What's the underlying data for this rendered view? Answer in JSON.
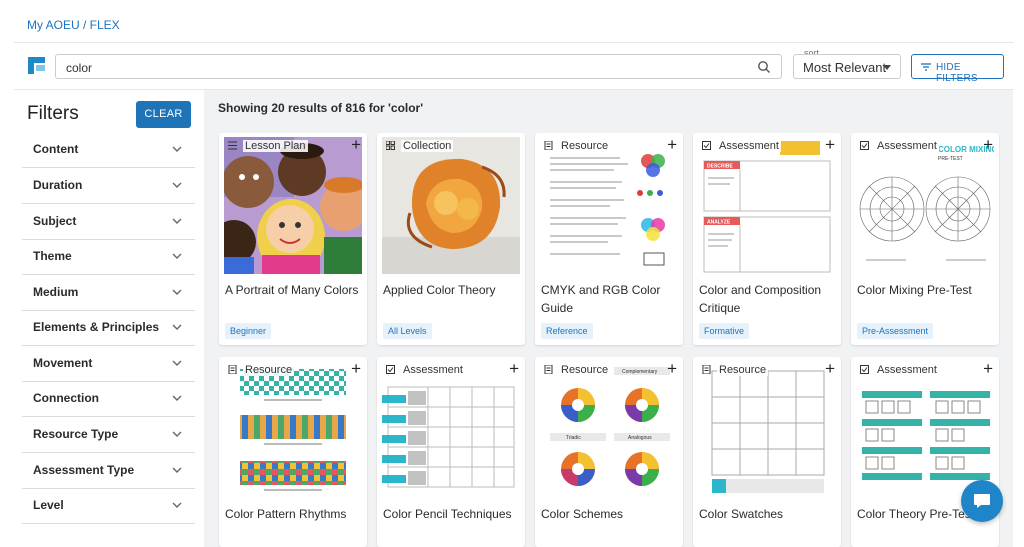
{
  "breadcrumb": "My AOEU / FLEX",
  "search": {
    "value": "color"
  },
  "sort": {
    "label": "sort",
    "value": "Most Relevant"
  },
  "hide_filters": "HIDE FILTERS",
  "filters": {
    "title": "Filters",
    "clear": "CLEAR",
    "items": [
      "Content",
      "Duration",
      "Subject",
      "Theme",
      "Medium",
      "Elements & Principles",
      "Movement",
      "Connection",
      "Resource Type",
      "Assessment Type",
      "Level"
    ]
  },
  "results_text": "Showing 20 results of 816 for 'color'",
  "cards": [
    {
      "type": "Lesson Plan",
      "title": "A Portrait of Many Colors",
      "tag": "Beginner"
    },
    {
      "type": "Collection",
      "title": "Applied Color Theory",
      "tag": "All Levels"
    },
    {
      "type": "Resource",
      "title": "CMYK and RGB Color Guide",
      "tag": "Reference"
    },
    {
      "type": "Assessment",
      "title": "Color and Composition Critique",
      "tag": "Formative"
    },
    {
      "type": "Assessment",
      "title": "Color Mixing Pre-Test",
      "tag": "Pre-Assessment"
    },
    {
      "type": "Resource",
      "title": "Color Pattern Rhythms",
      "tag": ""
    },
    {
      "type": "Assessment",
      "title": "Color Pencil Techniques",
      "tag": ""
    },
    {
      "type": "Resource",
      "title": "Color Schemes",
      "tag": ""
    },
    {
      "type": "Resource",
      "title": "Color Swatches",
      "tag": ""
    },
    {
      "type": "Assessment",
      "title": "Color Theory Pre-Test",
      "tag": ""
    }
  ],
  "thumb_text": {
    "critique": {
      "describe": "DESCRIBE",
      "analyze": "ANALYZE"
    },
    "pretest": {
      "heading": "COLOR MIXING",
      "sub": "PRE-TEST"
    },
    "schemes": {
      "complementary": "Complementary",
      "triadic": "Triadic",
      "analogous": "Analogous"
    }
  },
  "colors": {
    "accent": "#1f74b7",
    "link": "#1e73be",
    "main_bg": "#f1f2f4",
    "tag_bg": "#e6f2fb"
  }
}
